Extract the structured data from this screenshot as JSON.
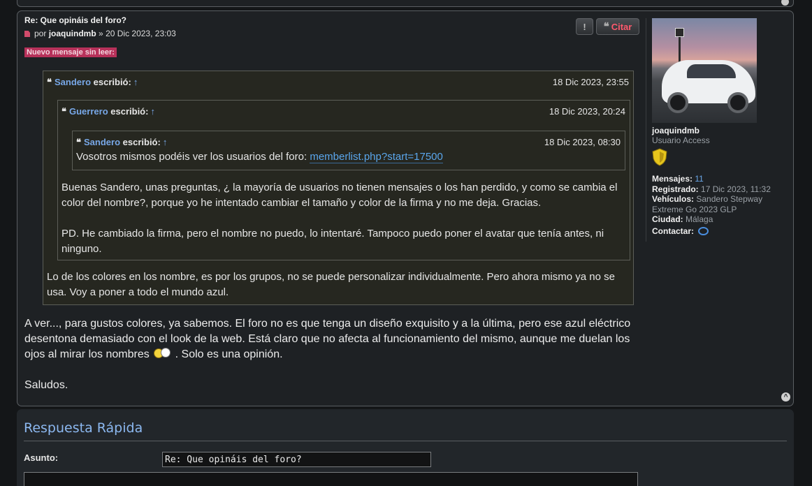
{
  "post": {
    "title": "Re: Que opináis del foro?",
    "author_prefix": "por",
    "author": "joaquindmb",
    "date_sep": "»",
    "date": "20 Dic 2023, 23:03",
    "unread_label": "Nuevo mensaje sin leer:",
    "buttons": {
      "report": "!",
      "quote_icon": "❝",
      "quote": "Citar"
    },
    "quote1": {
      "user": "Sandero",
      "wrote": "escribió:",
      "arrow": "↑",
      "date": "18 Dic 2023, 23:55",
      "text": "Lo de los colores en los nombre, es por los grupos, no se puede personalizar individualmente. Pero ahora mismo ya no se usa. Voy a poner a todo el mundo azul."
    },
    "quote2": {
      "user": "Guerrero",
      "wrote": "escribió:",
      "arrow": "↑",
      "date": "18 Dic 2023, 20:24",
      "text_p1": "Buenas Sandero, unas preguntas, ¿ la mayoría de usuarios no tienen mensajes o los han perdido, y como se cambia el color del nombre?, porque yo he intentado cambiar el tamaño y color de la firma y no me deja. Gracias.",
      "text_p2": "PD. He cambiado la firma, pero el nombre no puedo, lo intentaré. Tampoco puedo poner el avatar que tenía antes, ni ninguno."
    },
    "quote3": {
      "user": "Sandero",
      "wrote": "escribió:",
      "arrow": "↑",
      "date": "18 Dic 2023, 08:30",
      "text": "Vosotros mismos podéis ver los usuarios del foro:",
      "link": "memberlist.php?start=17500"
    },
    "body_p1_a": "A ver..., para gustos colores, ya sabemos. El foro no es que tenga un diseño exquisito y a la última, pero ese azul eléctrico desentona demasiado con el look de la web. Está claro que no afecta al funcionamiento del mismo, aunque me duelan los ojos al mirar los nombres",
    "body_p1_b": ". Solo es una opinión.",
    "body_p2": "Saludos."
  },
  "profile": {
    "username": "joaquindmb",
    "rank": "Usuario Access",
    "fields": [
      {
        "label": "Mensajes:",
        "value": "11"
      },
      {
        "label": "Registrado:",
        "value": "17 Dic 2023, 11:32"
      },
      {
        "label": "Vehículos:",
        "value": "Sandero Stepway Extreme Go 2023 GLP"
      },
      {
        "label": "Ciudad:",
        "value": "Málaga"
      },
      {
        "label": "Contactar:",
        "value": ""
      }
    ]
  },
  "reply": {
    "title": "Respuesta Rápida",
    "subject_label": "Asunto:",
    "subject_value": "Re: Que opináis del foro?"
  },
  "colors": {
    "accent_link": "#5aa6ec",
    "unread_bg": "#b7315a",
    "quote_button": "#ff5a6e"
  },
  "icons": [
    "post-file-icon",
    "warning-icon",
    "quote-icon",
    "up-arrow-icon",
    "smiley-icon",
    "rank-shield-icon",
    "contact-chat-icon",
    "back-to-top-icon"
  ]
}
